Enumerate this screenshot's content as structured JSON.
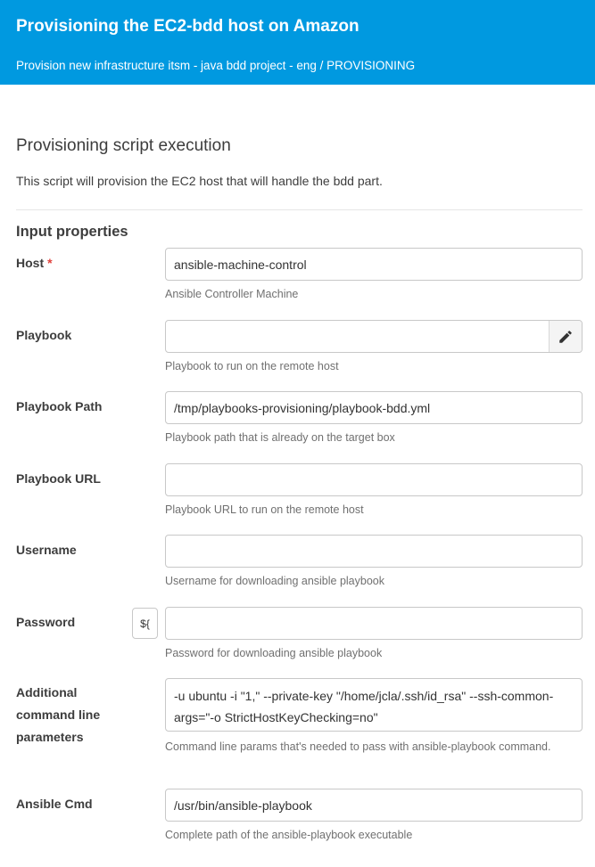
{
  "header": {
    "title": "Provisioning the EC2-bdd host on Amazon",
    "breadcrumb": "Provision new infrastructure itsm - java bdd project - eng / PROVISIONING"
  },
  "section": {
    "title": "Provisioning script execution",
    "description": "This script will provision the EC2 host that will handle the bdd part."
  },
  "input_properties": {
    "title": "Input properties",
    "required_marker": "*",
    "variable_button": "${",
    "edit_icon": "pencil-icon",
    "fields": {
      "host": {
        "label": "Host",
        "value": "ansible-machine-control",
        "help": "Ansible Controller Machine",
        "required": true
      },
      "playbook": {
        "label": "Playbook",
        "value": "",
        "help": "Playbook to run on the remote host"
      },
      "playbook_path": {
        "label": "Playbook Path",
        "value": "/tmp/playbooks-provisioning/playbook-bdd.yml",
        "help": "Playbook path that is already on the target box"
      },
      "playbook_url": {
        "label": "Playbook URL",
        "value": "",
        "help": "Playbook URL to run on the remote host"
      },
      "username": {
        "label": "Username",
        "value": "",
        "help": "Username for downloading ansible playbook"
      },
      "password": {
        "label": "Password",
        "value": "",
        "help": "Password for downloading ansible playbook"
      },
      "additional_params": {
        "label": "Additional command line parameters",
        "value": "-u ubuntu -i \"1,\" --private-key \"/home/jcla/.ssh/id_rsa\" --ssh-common-args=\"-o StrictHostKeyChecking=no\"",
        "help": "Command line params that's needed to pass with ansible-playbook command."
      },
      "ansible_cmd": {
        "label": "Ansible Cmd",
        "value": "/usr/bin/ansible-playbook",
        "help": "Complete path of the ansible-playbook executable"
      }
    }
  },
  "colors": {
    "header_bg": "#0099e0",
    "required": "#e0413c",
    "help_text": "#707070"
  }
}
